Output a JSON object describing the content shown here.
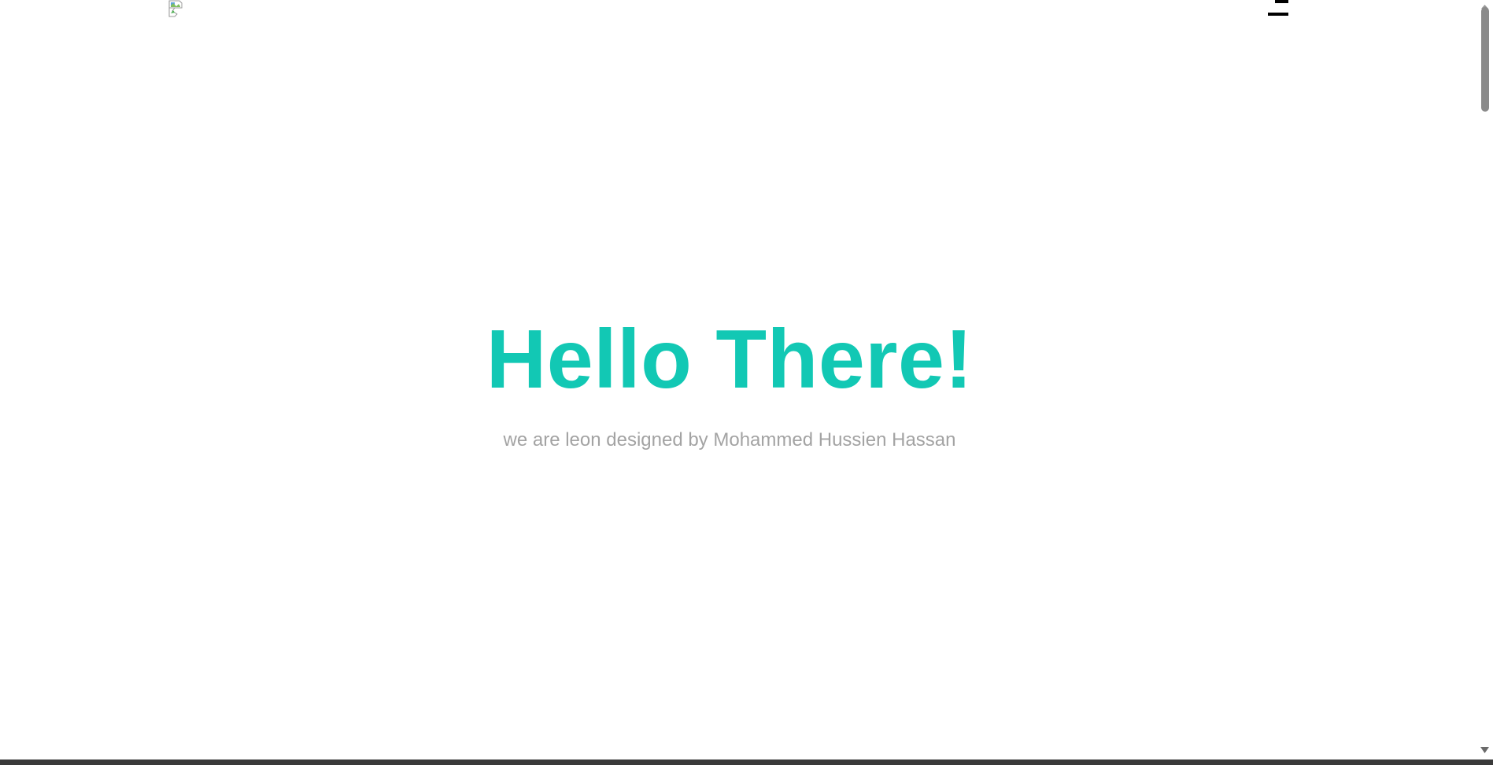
{
  "header": {
    "logo_alt": "logo",
    "logo_icon": "broken-image-icon",
    "menu_icon": "hamburger-menu-icon"
  },
  "hero": {
    "title": "Hello There!",
    "subtitle": "we are leon designed by Mohammed Hussien Hassan"
  },
  "colors": {
    "accent": "#12c8b4",
    "subtitle": "#a3a3a3",
    "background": "#ffffff",
    "scroll_thumb": "#8a8a8a"
  },
  "scrollbar": {
    "up_icon": "scroll-up-arrow-icon",
    "down_icon": "scroll-down-arrow-icon"
  }
}
